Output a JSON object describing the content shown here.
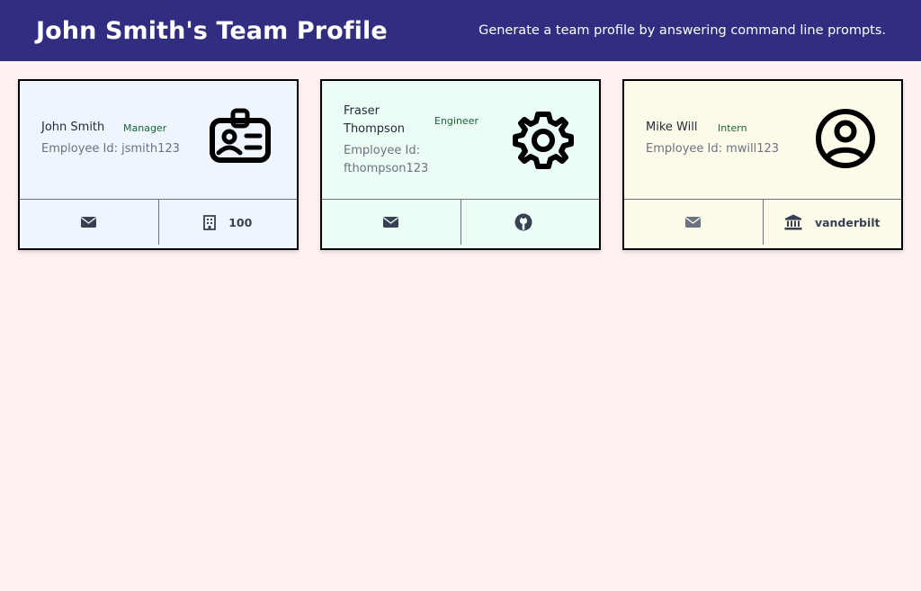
{
  "header": {
    "title": "John Smith's Team Profile",
    "subtitle": "Generate a team profile by answering command line prompts."
  },
  "cards": [
    {
      "name": "John Smith",
      "role": "Manager",
      "employee_id": "Employee Id: jsmith123",
      "icon": "id-badge-icon",
      "background": "#eff6ff",
      "detail_icon": "building-icon",
      "detail": "100"
    },
    {
      "name": "Fraser Thompson",
      "role": "Engineer",
      "employee_id": "Employee Id: fthompson123",
      "icon": "gear-icon",
      "background": "#ecfdf5",
      "detail_icon": "github-icon",
      "detail": ""
    },
    {
      "name": "Mike Will",
      "role": "Intern",
      "employee_id": "Employee Id: mwill123",
      "icon": "user-circle-icon",
      "background": "#fffbeb",
      "detail_icon": "school-icon",
      "detail": "vanderbilt"
    }
  ],
  "colors": {
    "header_bg": "#312e81",
    "page_bg": "#fff1f2",
    "role_text": "#166534"
  }
}
